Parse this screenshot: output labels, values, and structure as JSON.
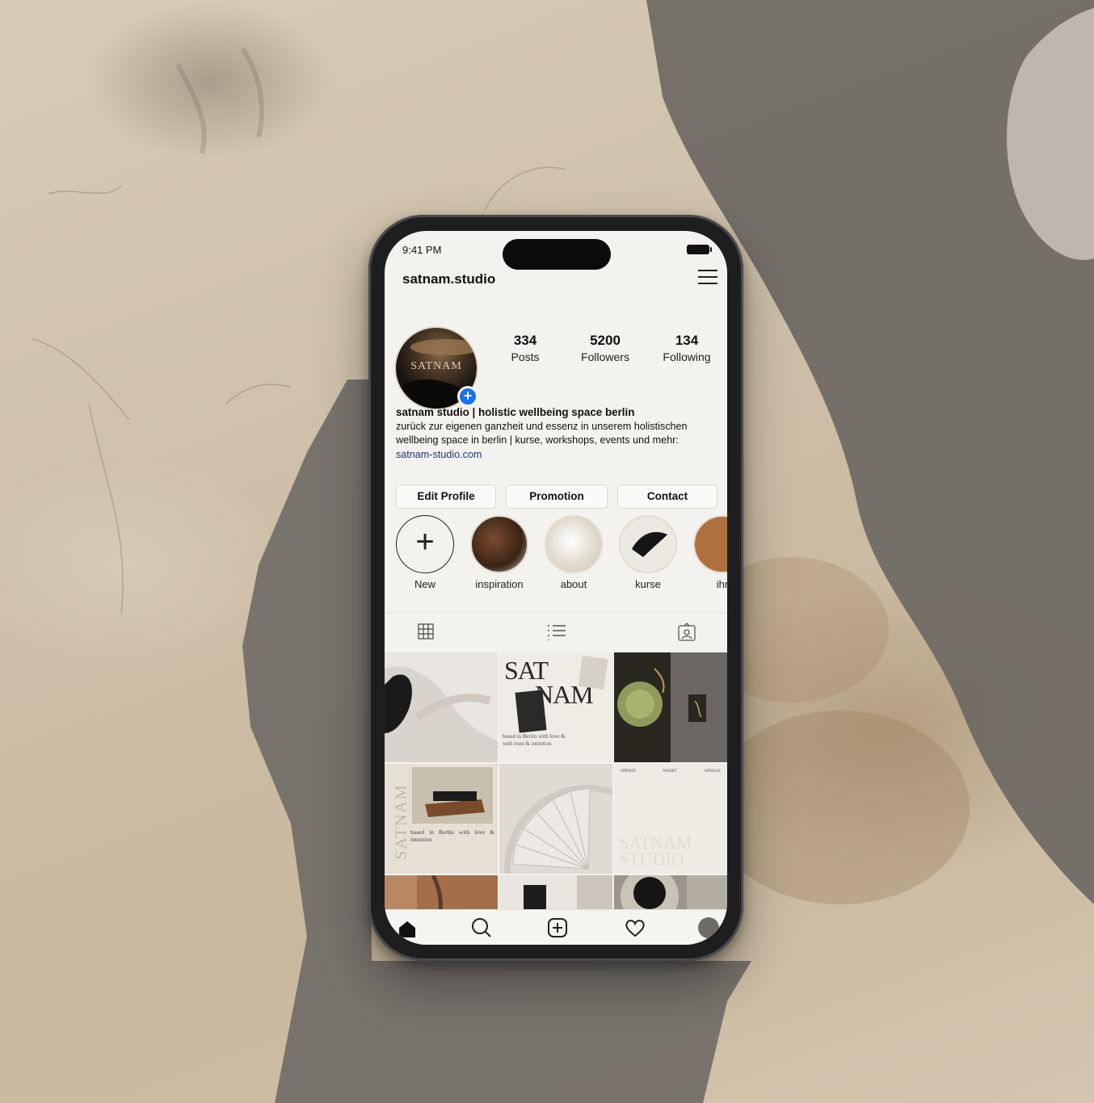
{
  "status": {
    "time": "9:41 PM"
  },
  "profile": {
    "username": "satnam.studio",
    "avatar_text": "SATNAM",
    "stats": [
      {
        "value": "334",
        "label": "Posts"
      },
      {
        "value": "5200",
        "label": "Followers"
      },
      {
        "value": "134",
        "label": "Following"
      }
    ],
    "bio_name": "satnam studio | holistic wellbeing space berlin",
    "bio_text": "zurück zur eigenen ganzheit und essenz in unserem holistischen wellbeing space in berlin | kurse, workshops, events und mehr:",
    "bio_link": "satnam-studio.com"
  },
  "buttons": {
    "edit": "Edit Profile",
    "promotion": "Promotion",
    "contact": "Contact"
  },
  "highlights": [
    {
      "label": "New"
    },
    {
      "label": "inspiration"
    },
    {
      "label": "about"
    },
    {
      "label": "kurse"
    },
    {
      "label": "ihr"
    }
  ],
  "posts": {
    "p2_title_a": "SAT",
    "p2_title_b": "NAM",
    "p2_caption": "based in Berlin with love & with trust & intention",
    "p4_vertical": "SATNAM",
    "p4_caption": "based in Berlin with love & intention",
    "p6_top_a": "refresh",
    "p6_top_b": "restart",
    "p6_top_c": "refocus",
    "p6_title_a": "SATNAM",
    "p6_title_b": "STUDIO"
  },
  "icons": {
    "menu": "hamburger-icon",
    "tabs": [
      "grid-icon",
      "list-icon",
      "tagged-icon"
    ],
    "nav": [
      "home-icon",
      "search-icon",
      "add-post-icon",
      "heart-icon",
      "profile-icon"
    ]
  },
  "colors": {
    "accent": "#1a73e8",
    "link": "#1b3a7a",
    "screen_bg": "#f4f2ee"
  }
}
